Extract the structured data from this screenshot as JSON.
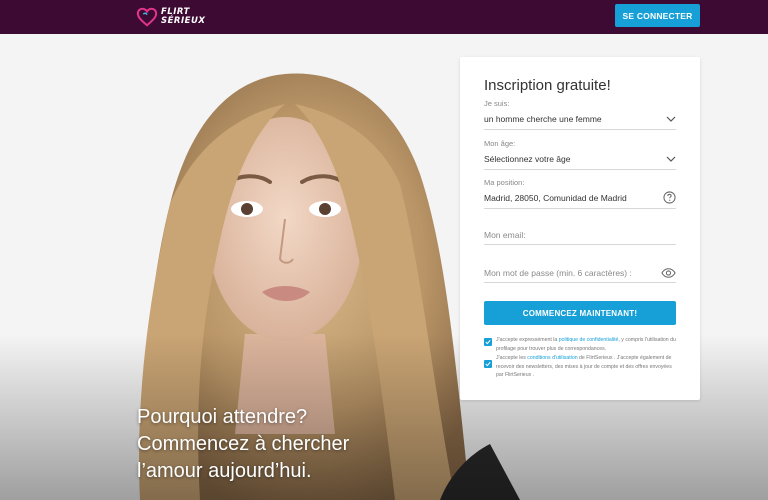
{
  "brand": {
    "logo_line1": "Flirt",
    "logo_line2": "Sérieux",
    "color_bar": "#3d0a33",
    "accent": "#17a0d8",
    "logo_heart_color": "#e0358a"
  },
  "header": {
    "login_label": "SE CONNECTER"
  },
  "hero": {
    "tagline": [
      "Pourquoi attendre?",
      "Commencez à chercher",
      "l’amour aujourd’hui."
    ],
    "image": "portrait-of-young-blonde-woman"
  },
  "form": {
    "title": "Inscription gratuite!",
    "seeking": {
      "label": "Je suis:",
      "value": "un homme cherche une femme",
      "icon": "chevron-down-icon"
    },
    "age": {
      "label": "Mon âge:",
      "value": "Sélectionnez votre âge",
      "icon": "chevron-down-icon"
    },
    "position": {
      "label": "Ma position:",
      "value": "Madrid, 28050, Comunidad de Madrid",
      "icon": "help-circle-icon"
    },
    "email": {
      "placeholder": "Mon email:"
    },
    "password": {
      "placeholder": "Mon mot de passe (min. 6 caractères) :",
      "icon": "eye-icon"
    },
    "submit_label": "COMMENCEZ MAINTENANT!",
    "consent_privacy": {
      "before": "J'accepte expressément la ",
      "link": "politique de confidentialité",
      "after": ", y compris l'utilisation du profilage pour trouver plus de correspondances.",
      "checked": true
    },
    "consent_terms": {
      "before": "J'accepte les ",
      "link": "conditions d'utilisation",
      "after": " de FlirtSerieux . J'accepte également de recevoir des newsletters, des mises à jour de compte et des offres envoyées par FlirtSerieux .",
      "checked": true
    }
  }
}
